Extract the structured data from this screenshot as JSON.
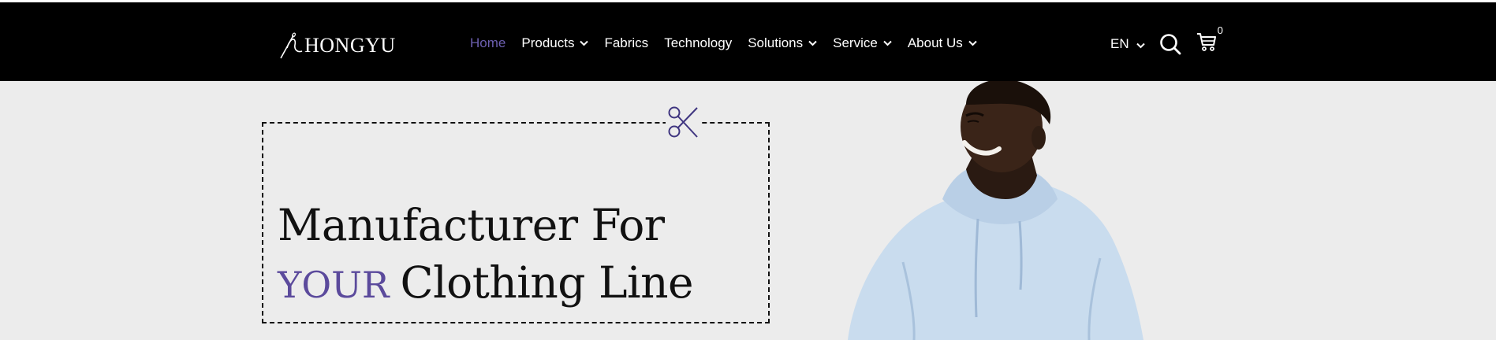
{
  "brand": {
    "name": "HONGYU"
  },
  "nav": {
    "items": [
      {
        "label": "Home",
        "active": true,
        "dropdown": false
      },
      {
        "label": "Products",
        "active": false,
        "dropdown": true
      },
      {
        "label": "Fabrics",
        "active": false,
        "dropdown": false
      },
      {
        "label": "Technology",
        "active": false,
        "dropdown": false
      },
      {
        "label": "Solutions",
        "active": false,
        "dropdown": true
      },
      {
        "label": "Service",
        "active": false,
        "dropdown": true
      },
      {
        "label": "About Us",
        "active": false,
        "dropdown": true
      }
    ]
  },
  "tools": {
    "language": "EN",
    "cart_count": "0",
    "icons": [
      "chevron-down-icon",
      "search-icon",
      "cart-icon"
    ]
  },
  "hero": {
    "headline_line1": "Manufacturer For",
    "headline_accent": "YOUR",
    "headline_line2": "Clothing Line",
    "decoration_icon": "scissors-icon",
    "image": "smiling man wearing light blue hoodie"
  },
  "colors": {
    "navbar_bg": "#000000",
    "page_bg": "#ececec",
    "accent": "#5b4a9c",
    "nav_active": "#6c5fb0",
    "hoodie": "#c9dcee"
  }
}
